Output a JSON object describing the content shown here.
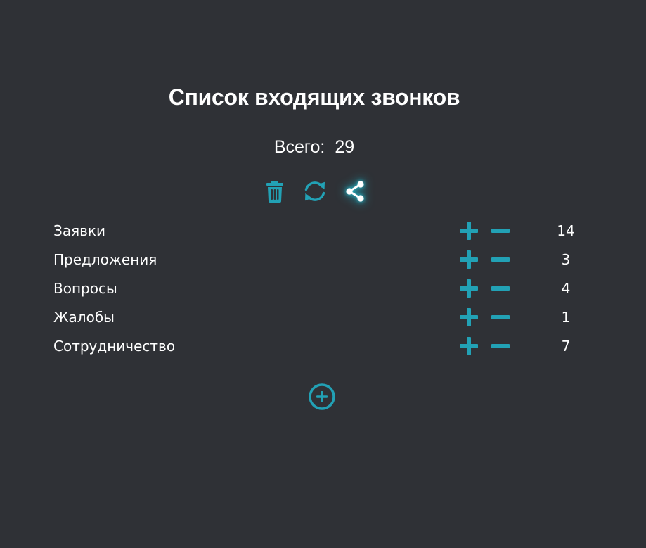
{
  "header": {
    "title": "Список входящих звонков",
    "total_label": "Всего:",
    "total_value": "29"
  },
  "toolbar": {
    "icons": [
      "trash-icon",
      "refresh-icon",
      "share-icon"
    ]
  },
  "colors": {
    "background": "#2f3136",
    "accent": "#22a1b5",
    "text": "#ffffff",
    "glow": "#29c9dd"
  },
  "categories": [
    {
      "label": "Заявки",
      "count": "14"
    },
    {
      "label": "Предложения",
      "count": "3"
    },
    {
      "label": "Вопросы",
      "count": "4"
    },
    {
      "label": "Жалобы",
      "count": "1"
    },
    {
      "label": "Сотрудничество",
      "count": "7"
    }
  ]
}
